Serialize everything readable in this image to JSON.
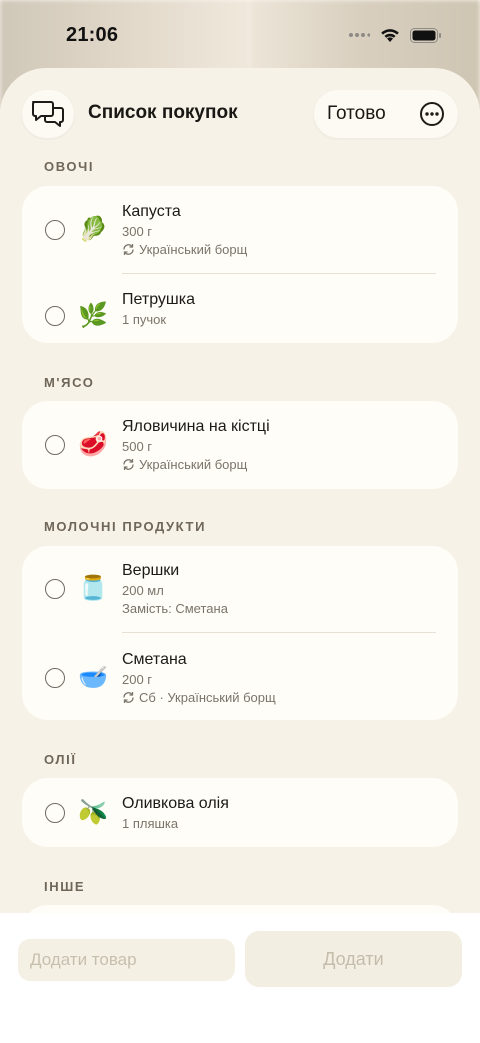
{
  "status_bar": {
    "time": "21:06"
  },
  "header": {
    "title": "Список покупок",
    "done_label": "Готово",
    "chat_icon": "chat-bubbles-icon",
    "more_icon": "ellipsis-circle-icon"
  },
  "sections": [
    {
      "title": "ОВОЧІ",
      "items": [
        {
          "name": "Капуста",
          "qty": "300 г",
          "source": "Український борщ",
          "icon": "cabbage-icon"
        },
        {
          "name": "Петрушка",
          "qty": "1 пучок",
          "icon": "parsley-icon"
        }
      ]
    },
    {
      "title": "М'ЯСО",
      "items": [
        {
          "name": "Яловичина на кістці",
          "qty": "500 г",
          "source": "Український борщ",
          "icon": "beef-icon"
        }
      ]
    },
    {
      "title": "МОЛОЧНІ ПРОДУКТИ",
      "items": [
        {
          "name": "Вершки",
          "qty": "200 мл",
          "note": "Замість: Сметана",
          "icon": "jug-icon"
        },
        {
          "name": "Сметана",
          "qty": "200 г",
          "source": "Сб · Український борщ",
          "icon": "bowl-icon"
        }
      ]
    },
    {
      "title": "ОЛІЇ",
      "items": [
        {
          "name": "Оливкова олія",
          "qty": "1 пляшка",
          "icon": "olive-oil-icon"
        }
      ]
    },
    {
      "title": "ІНШЕ",
      "items": []
    }
  ],
  "bottom_bar": {
    "input_placeholder": "Додати товар",
    "add_button": "Додати"
  }
}
